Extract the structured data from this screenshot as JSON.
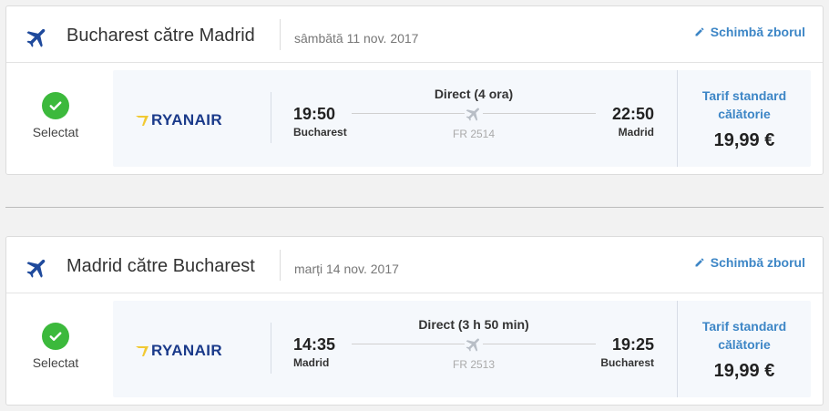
{
  "colors": {
    "accent": "#3d86c6",
    "selected": "#3cb93c",
    "airline": "#1a3a8a",
    "panel": "#f5f8fc"
  },
  "outbound": {
    "title": "Bucharest către Madrid",
    "date": "sâmbătă 11 nov. 2017",
    "change_label": "Schimbă zborul",
    "selected_label": "Selectat",
    "airline": "RYANAIR",
    "dep_time": "19:50",
    "dep_city": "Bucharest",
    "duration": "Direct (4 ora)",
    "flight_no": "FR 2514",
    "arr_time": "22:50",
    "arr_city": "Madrid",
    "fare_name": "Tarif standard călătorie",
    "price": "19,99 €",
    "icon": "airplane-icon"
  },
  "inbound": {
    "title": "Madrid către Bucharest",
    "date": "marți 14 nov. 2017",
    "change_label": "Schimbă zborul",
    "selected_label": "Selectat",
    "airline": "RYANAIR",
    "dep_time": "14:35",
    "dep_city": "Madrid",
    "duration": "Direct (3 h 50 min)",
    "flight_no": "FR 2513",
    "arr_time": "19:25",
    "arr_city": "Bucharest",
    "fare_name": "Tarif standard călătorie",
    "price": "19,99 €",
    "icon": "airplane-icon"
  }
}
